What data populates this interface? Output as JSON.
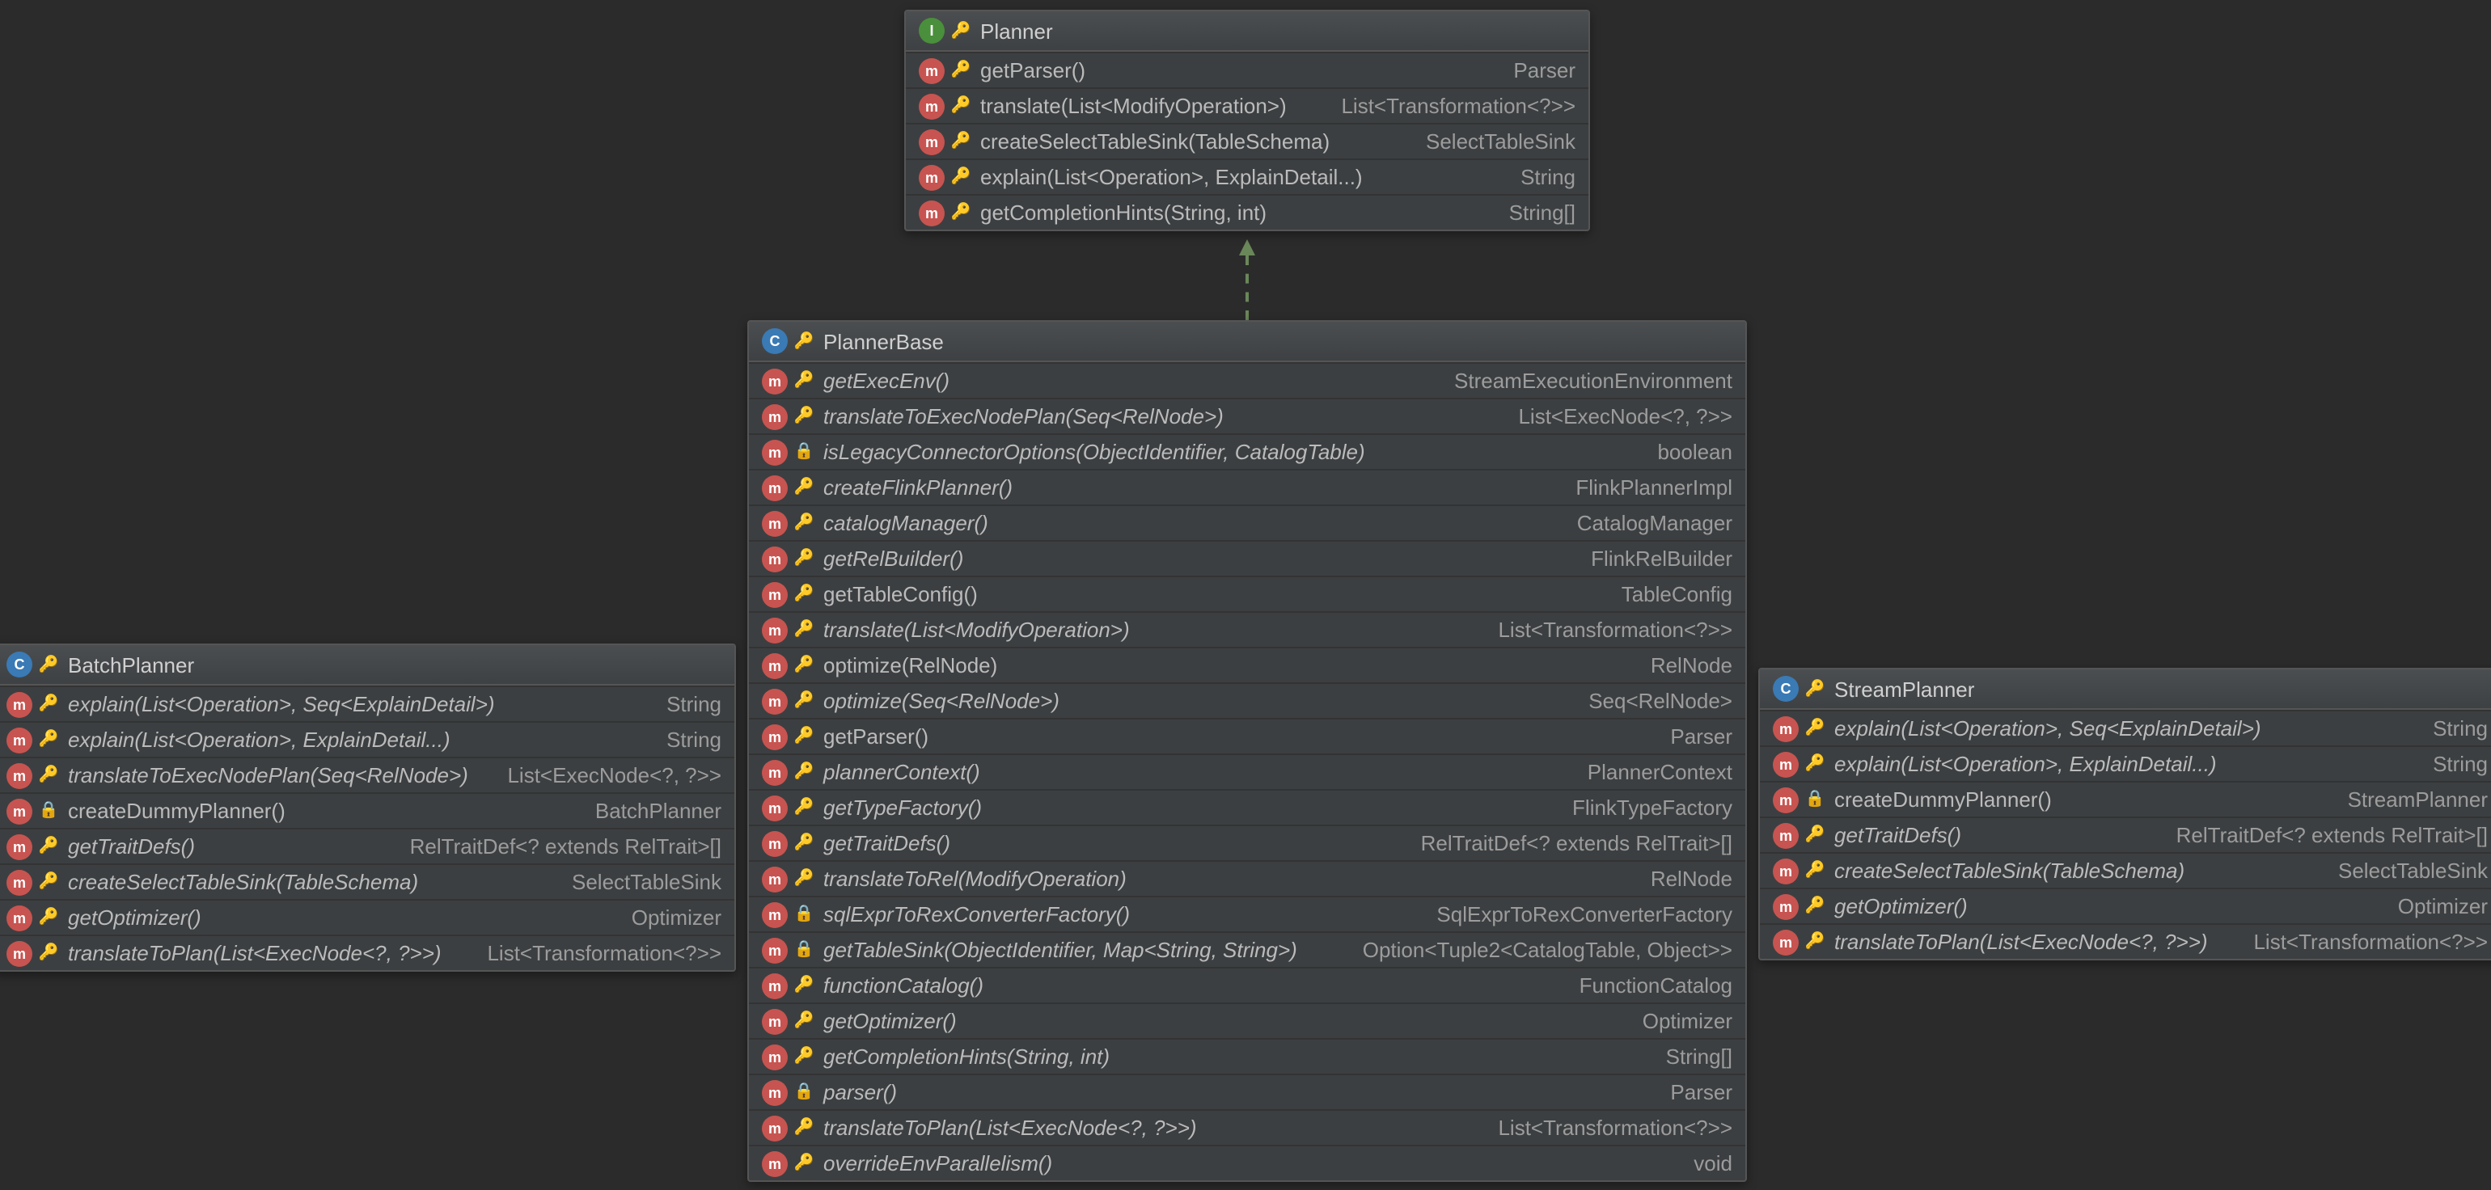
{
  "planner": {
    "title": "Planner",
    "icon_kind": "interface",
    "methods": [
      {
        "sig": "getParser()",
        "ret": "Parser",
        "vis": "key",
        "italic": false
      },
      {
        "sig": "translate(List<ModifyOperation>)",
        "ret": "List<Transformation<?>>",
        "vis": "key",
        "italic": false
      },
      {
        "sig": "createSelectTableSink(TableSchema)",
        "ret": "SelectTableSink",
        "vis": "key",
        "italic": false
      },
      {
        "sig": "explain(List<Operation>, ExplainDetail...)",
        "ret": "String",
        "vis": "key",
        "italic": false
      },
      {
        "sig": "getCompletionHints(String, int)",
        "ret": "String[]",
        "vis": "key",
        "italic": false
      }
    ]
  },
  "plannerBase": {
    "title": "PlannerBase",
    "icon_kind": "class",
    "methods": [
      {
        "sig": "getExecEnv()",
        "ret": "StreamExecutionEnvironment",
        "vis": "key",
        "italic": true
      },
      {
        "sig": "translateToExecNodePlan(Seq<RelNode>)",
        "ret": "List<ExecNode<?, ?>>",
        "vis": "key",
        "italic": true
      },
      {
        "sig": "isLegacyConnectorOptions(ObjectIdentifier, CatalogTable)",
        "ret": "boolean",
        "vis": "lock",
        "italic": true
      },
      {
        "sig": "createFlinkPlanner()",
        "ret": "FlinkPlannerImpl",
        "vis": "key",
        "italic": true
      },
      {
        "sig": "catalogManager()",
        "ret": "CatalogManager",
        "vis": "key",
        "italic": true
      },
      {
        "sig": "getRelBuilder()",
        "ret": "FlinkRelBuilder",
        "vis": "key",
        "italic": true
      },
      {
        "sig": "getTableConfig()",
        "ret": "TableConfig",
        "vis": "key",
        "italic": false
      },
      {
        "sig": "translate(List<ModifyOperation>)",
        "ret": "List<Transformation<?>>",
        "vis": "key",
        "italic": true
      },
      {
        "sig": "optimize(RelNode)",
        "ret": "RelNode",
        "vis": "key",
        "italic": false
      },
      {
        "sig": "optimize(Seq<RelNode>)",
        "ret": "Seq<RelNode>",
        "vis": "key",
        "italic": true
      },
      {
        "sig": "getParser()",
        "ret": "Parser",
        "vis": "key",
        "italic": false
      },
      {
        "sig": "plannerContext()",
        "ret": "PlannerContext",
        "vis": "key",
        "italic": true
      },
      {
        "sig": "getTypeFactory()",
        "ret": "FlinkTypeFactory",
        "vis": "key",
        "italic": true
      },
      {
        "sig": "getTraitDefs()",
        "ret": "RelTraitDef<? extends RelTrait>[]",
        "vis": "key",
        "italic": true
      },
      {
        "sig": "translateToRel(ModifyOperation)",
        "ret": "RelNode",
        "vis": "key",
        "italic": true
      },
      {
        "sig": "sqlExprToRexConverterFactory()",
        "ret": "SqlExprToRexConverterFactory",
        "vis": "lock",
        "italic": true
      },
      {
        "sig": "getTableSink(ObjectIdentifier, Map<String, String>)",
        "ret": "Option<Tuple2<CatalogTable, Object>>",
        "vis": "lock",
        "italic": true
      },
      {
        "sig": "functionCatalog()",
        "ret": "FunctionCatalog",
        "vis": "key",
        "italic": true
      },
      {
        "sig": "getOptimizer()",
        "ret": "Optimizer",
        "vis": "key",
        "italic": true
      },
      {
        "sig": "getCompletionHints(String, int)",
        "ret": "String[]",
        "vis": "key",
        "italic": true
      },
      {
        "sig": "parser()",
        "ret": "Parser",
        "vis": "lock",
        "italic": true
      },
      {
        "sig": "translateToPlan(List<ExecNode<?, ?>>)",
        "ret": "List<Transformation<?>>",
        "vis": "key",
        "italic": true
      },
      {
        "sig": "overrideEnvParallelism()",
        "ret": "void",
        "vis": "key",
        "italic": true
      }
    ]
  },
  "batchPlanner": {
    "title": "BatchPlanner",
    "icon_kind": "class",
    "methods": [
      {
        "sig": "explain(List<Operation>, Seq<ExplainDetail>)",
        "ret": "String",
        "vis": "key",
        "italic": true
      },
      {
        "sig": "explain(List<Operation>, ExplainDetail...)",
        "ret": "String",
        "vis": "key",
        "italic": true
      },
      {
        "sig": "translateToExecNodePlan(Seq<RelNode>)",
        "ret": "List<ExecNode<?, ?>>",
        "vis": "key",
        "italic": true
      },
      {
        "sig": "createDummyPlanner()",
        "ret": "BatchPlanner",
        "vis": "lock",
        "italic": false
      },
      {
        "sig": "getTraitDefs()",
        "ret": "RelTraitDef<? extends RelTrait>[]",
        "vis": "key",
        "italic": true
      },
      {
        "sig": "createSelectTableSink(TableSchema)",
        "ret": "SelectTableSink",
        "vis": "key",
        "italic": true
      },
      {
        "sig": "getOptimizer()",
        "ret": "Optimizer",
        "vis": "key",
        "italic": true
      },
      {
        "sig": "translateToPlan(List<ExecNode<?, ?>>)",
        "ret": "List<Transformation<?>>",
        "vis": "key",
        "italic": true
      }
    ]
  },
  "streamPlanner": {
    "title": "StreamPlanner",
    "icon_kind": "class",
    "methods": [
      {
        "sig": "explain(List<Operation>, Seq<ExplainDetail>)",
        "ret": "String",
        "vis": "key",
        "italic": true
      },
      {
        "sig": "explain(List<Operation>, ExplainDetail...)",
        "ret": "String",
        "vis": "key",
        "italic": true
      },
      {
        "sig": "createDummyPlanner()",
        "ret": "StreamPlanner",
        "vis": "lock",
        "italic": false
      },
      {
        "sig": "getTraitDefs()",
        "ret": "RelTraitDef<? extends RelTrait>[]",
        "vis": "key",
        "italic": true
      },
      {
        "sig": "createSelectTableSink(TableSchema)",
        "ret": "SelectTableSink",
        "vis": "key",
        "italic": true
      },
      {
        "sig": "getOptimizer()",
        "ret": "Optimizer",
        "vis": "key",
        "italic": true
      },
      {
        "sig": "translateToPlan(List<ExecNode<?, ?>>)",
        "ret": "List<Transformation<?>>",
        "vis": "key",
        "italic": true
      }
    ]
  }
}
